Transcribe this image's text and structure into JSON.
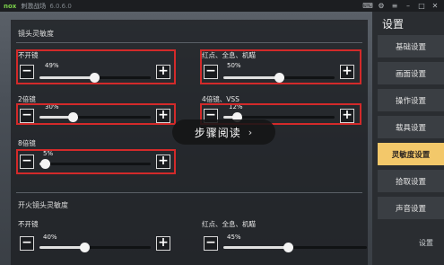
{
  "titlebar": {
    "logo": "nox",
    "app_title": "刺激战场",
    "version": "6.0.6.0"
  },
  "main": {
    "scope_section_title": "镜头灵敏度",
    "fire_section_title": "开火镜头灵敏度",
    "scope_sliders": [
      {
        "label": "不开镜",
        "value": "49%",
        "level": 0.49
      },
      {
        "label": "红点、全息、机瞄",
        "value": "50%",
        "level": 0.5
      },
      {
        "label": "2倍镜",
        "value": "30%",
        "level": 0.3
      },
      {
        "label": "4倍镜、VSS",
        "value": "12%",
        "level": 0.12
      },
      {
        "label": "8倍镜",
        "value": "5%",
        "level": 0.05
      }
    ],
    "fire_sliders": [
      {
        "label": "不开镜",
        "value": "40%",
        "level": 0.4
      },
      {
        "label": "红点、全息、机瞄",
        "value": "45%",
        "level": 0.45
      }
    ],
    "minus": "−",
    "plus": "+"
  },
  "sidebar": {
    "title": "设置",
    "back": "‹",
    "items": [
      {
        "label": "基础设置"
      },
      {
        "label": "画面设置"
      },
      {
        "label": "操作设置"
      },
      {
        "label": "载具设置"
      },
      {
        "label": "灵敏度设置"
      },
      {
        "label": "拾取设置"
      },
      {
        "label": "声音设置"
      }
    ],
    "active_index": 4,
    "bottom_label": "设置"
  },
  "overlay": {
    "text": "步骤阅读",
    "chevron": "›"
  },
  "colors": {
    "highlight": "#d32a2a",
    "active_tab": "#f3c86a"
  }
}
